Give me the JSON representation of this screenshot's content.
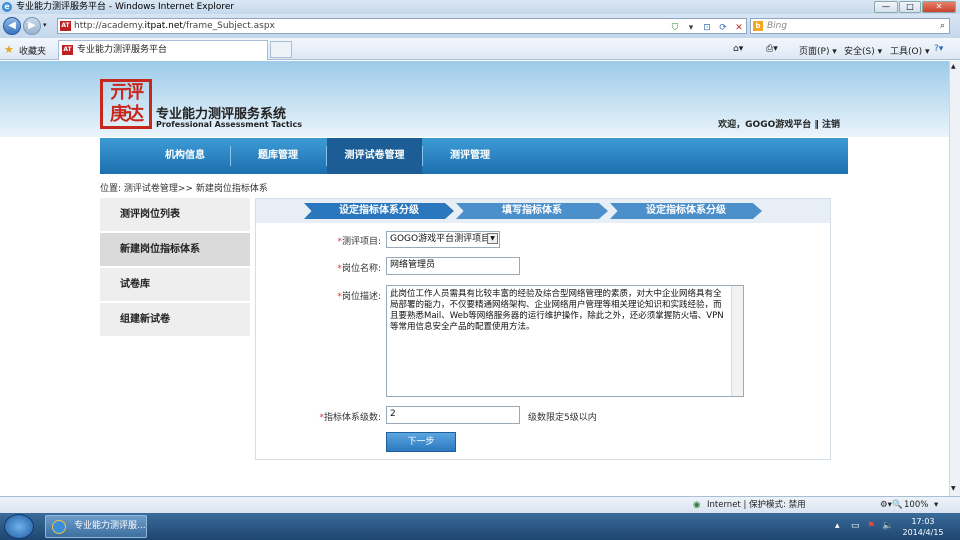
{
  "window": {
    "title": "专业能力测评服务平台 - Windows Internet Explorer",
    "minimize": "—",
    "maximize": "□",
    "close": "✕"
  },
  "addressbar": {
    "url_prefix": "http://academy.",
    "url_domain": "itpat.net",
    "url_path": "/frame_Subject.aspx",
    "search_placeholder": "Bing"
  },
  "favbar": {
    "favorites_label": "收藏夹",
    "tab_title": "专业能力测评服务平台",
    "page_menu": "页面(P) ▾",
    "safety_menu": "安全(S) ▾",
    "tools_menu": "工具(O) ▾"
  },
  "site": {
    "logo_glyphs": "亓评\n庚达",
    "title": "专业能力测评服务系统",
    "subtitle": "Professional Assessment Tactics",
    "welcome": "欢迎，GOGO游戏平台 ‖ 注销"
  },
  "nav": {
    "items": [
      "机构信息",
      "题库管理",
      "测评试卷管理",
      "测评管理"
    ],
    "active_index": 2
  },
  "breadcrumb": "位置: 测评试卷管理>> 新建岗位指标体系",
  "sidebar": {
    "items": [
      "测评岗位列表",
      "新建岗位指标体系",
      "试卷库",
      "组建新试卷"
    ],
    "active_index": 1
  },
  "steps": [
    "设定指标体系分级",
    "填写指标体系",
    "设定指标体系分级"
  ],
  "form": {
    "project_label": "测评项目:",
    "project_value": "GOGO游戏平台测评项目",
    "position_label": "岗位名称:",
    "position_value": "网络管理员",
    "desc_label": "岗位描述:",
    "desc_value": "此岗位工作人员需具有比较丰富的经验及综合型网络管理的素质，对大中企业网络具有全局部署的能力，不仅要精通网络架构、企业网络用户管理等相关理论知识和实践经验，而且要熟悉Mail、Web等网络服务器的运行维护操作，除此之外，还必须掌握防火墙、VPN等常用信息安全产品的配置使用方法。",
    "levels_label": "指标体系级数:",
    "levels_value": "2",
    "levels_hint": "级数限定5级以内",
    "next_button": "下一步"
  },
  "statusbar": {
    "zone": "Internet | 保护模式: 禁用",
    "zoom": "100%"
  },
  "taskbar": {
    "ie_task": "专业能力测评服...",
    "time": "17:03",
    "date": "2014/4/15"
  }
}
